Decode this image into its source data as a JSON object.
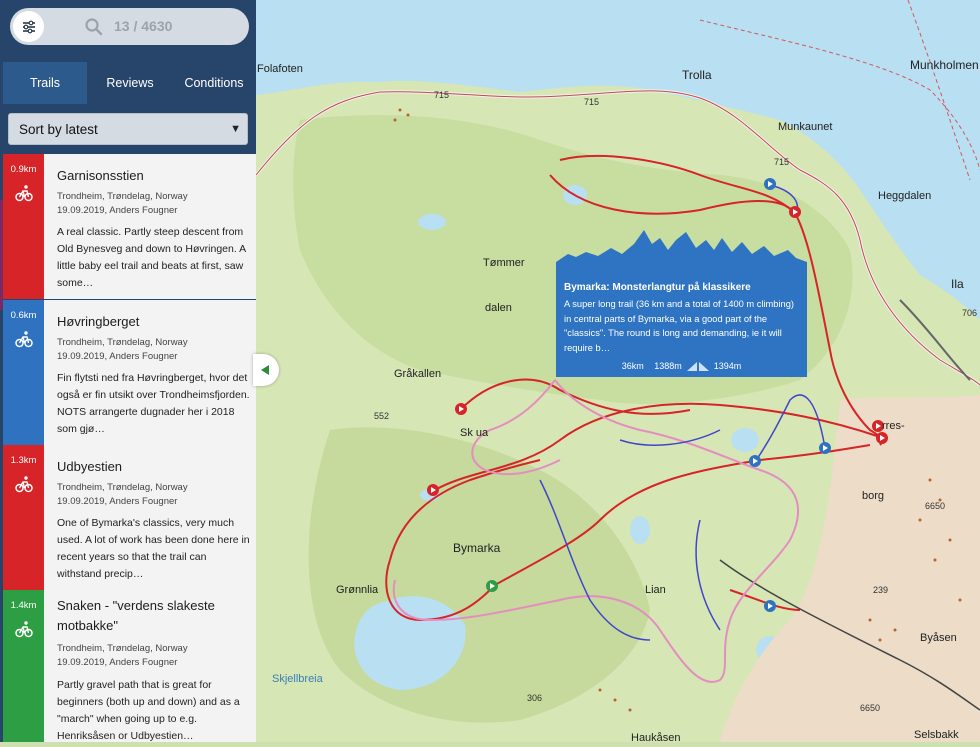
{
  "search": {
    "count": "13 / 4630"
  },
  "tabs": [
    {
      "label": "Trails"
    },
    {
      "label": "Reviews"
    },
    {
      "label": "Conditions"
    }
  ],
  "sort": {
    "selected": "Sort by latest"
  },
  "trails": [
    {
      "distance": "0.9km",
      "color": "#d62428",
      "name": "Garnisonsstien",
      "location": "Trondheim, Trøndelag, Norway",
      "meta": "19.09.2019, Anders Fougner",
      "description": "A real classic. Partly steep descent from Old Bynesveg and down to Høvringen. A little baby eel trail and beats at first, saw some…"
    },
    {
      "distance": "0.6km",
      "color": "#2f72c0",
      "name": "Høvringberget",
      "location": "Trondheim, Trøndelag, Norway",
      "meta": "19.09.2019, Anders Fougner",
      "description": "Fin flytsti ned fra Høvringberget, hvor det også er fin utsikt over Trondheimsfjorden. NOTS arrangerte dugnader her i 2018 som gjø…"
    },
    {
      "distance": "1.3km",
      "color": "#d62428",
      "name": "Udbyestien",
      "location": "Trondheim, Trøndelag, Norway",
      "meta": "19.09.2019, Anders Fougner",
      "description": "One of Bymarka's classics, very much used. A lot of work has been done here in recent years so that the trail can withstand precip…"
    },
    {
      "distance": "1.4km",
      "color": "#2e9e44",
      "name": "Snaken - \"verdens slakeste motbakke\"",
      "location": "Trondheim, Trøndelag, Norway",
      "meta": "19.09.2019, Anders Fougner",
      "description": "Partly gravel path that is great for beginners (both up and down) and as a \"march\" when going up to e.g. Henriksåsen or Udbyestien…"
    }
  ],
  "popup": {
    "title": "Bymarka: Monsterlangtur på klassikere",
    "description": "A super long trail (36 km and a total of 1400 m climbing) in central parts of Bymarka, via a good part of the \"classics\". The round is long and demanding, ie it will require b…",
    "distance": "36km",
    "climb": "1388m",
    "descent": "1394m"
  },
  "map_labels": {
    "folafoten": "Folafoten",
    "trolla": "Trolla",
    "munkholmen": "Munkholmen",
    "munkaunet": "Munkaunet",
    "heggdalen": "Heggdalen",
    "ila": "Ila",
    "tommer": "Tømmer",
    "dalen": "dalen",
    "grakallen": "Gråkallen",
    "skistua": "Sk   ua",
    "bymarka": "Bymarka",
    "gronnlia": "Grønnlia",
    "lian": "Lian",
    "skjellbreia": "Skjellbreia",
    "borg": "borg",
    "byasen": "Byåsen",
    "selsbakk": "Selsbakk",
    "hauka": "Haukåsen",
    "bymarka_trondheim_road_1": "715",
    "road_715b": "715",
    "road_715c": "715",
    "road_552": "552",
    "road_306": "306",
    "road_6650": "6650",
    "road_6650b": "6650",
    "road_239": "239",
    "road_706": "706",
    "orres": "rres-"
  },
  "colors": {
    "sidebar": "#27456b",
    "popup": "#2f74c2",
    "red_trail": "#d62428",
    "blue_trail": "#2f72c0",
    "green_trail": "#2e9e44"
  }
}
